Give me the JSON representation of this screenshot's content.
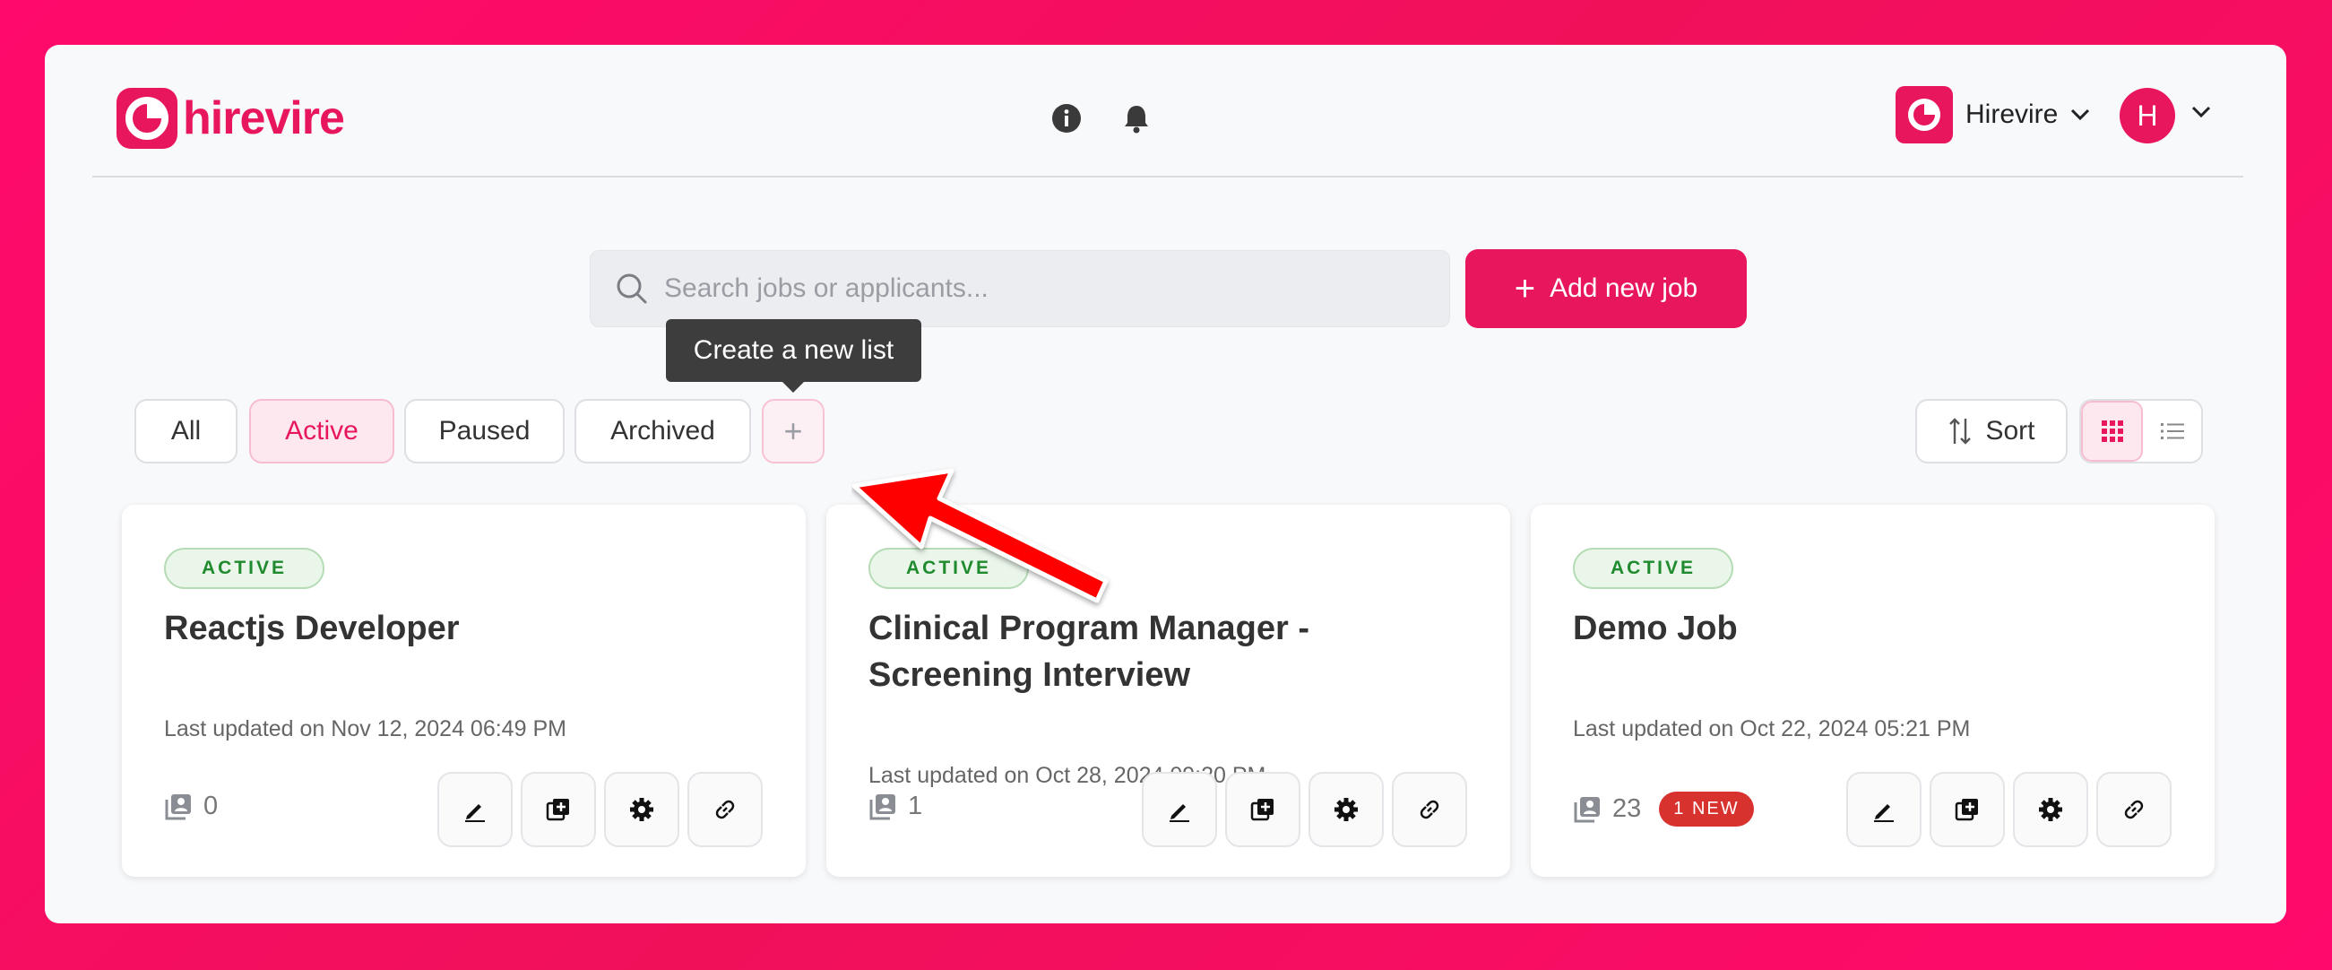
{
  "brand": {
    "name": "hirevire",
    "color": "#e8175d"
  },
  "header": {
    "org_name": "Hirevire",
    "user_initial": "H",
    "icons": [
      "info-icon",
      "bell-icon"
    ]
  },
  "search": {
    "placeholder": "Search jobs or applicants...",
    "value": ""
  },
  "add_job": {
    "label": "Add new job"
  },
  "tooltip": {
    "text": "Create a new list"
  },
  "tabs": [
    {
      "label": "All",
      "active": false
    },
    {
      "label": "Active",
      "active": true
    },
    {
      "label": "Paused",
      "active": false
    },
    {
      "label": "Archived",
      "active": false
    }
  ],
  "add_list_symbol": "+",
  "sort": {
    "label": "Sort"
  },
  "view": {
    "selected": "grid"
  },
  "jobs": [
    {
      "status": "ACTIVE",
      "title": "Reactjs Developer",
      "updated": "Last updated on Nov 12, 2024 06:49 PM",
      "applicants": "0",
      "new_badge": ""
    },
    {
      "status": "ACTIVE",
      "title": "Clinical Program Manager - Screening Interview",
      "updated": "Last updated on Oct 28, 2024 09:20 PM",
      "applicants": "1",
      "new_badge": ""
    },
    {
      "status": "ACTIVE",
      "title": "Demo Job",
      "updated": "Last updated on Oct 22, 2024 05:21 PM",
      "applicants": "23",
      "new_badge": "1 NEW"
    }
  ],
  "colors": {
    "accent": "#e8175d",
    "status_green": "#1f8a2e",
    "new_badge": "#d8322f"
  }
}
